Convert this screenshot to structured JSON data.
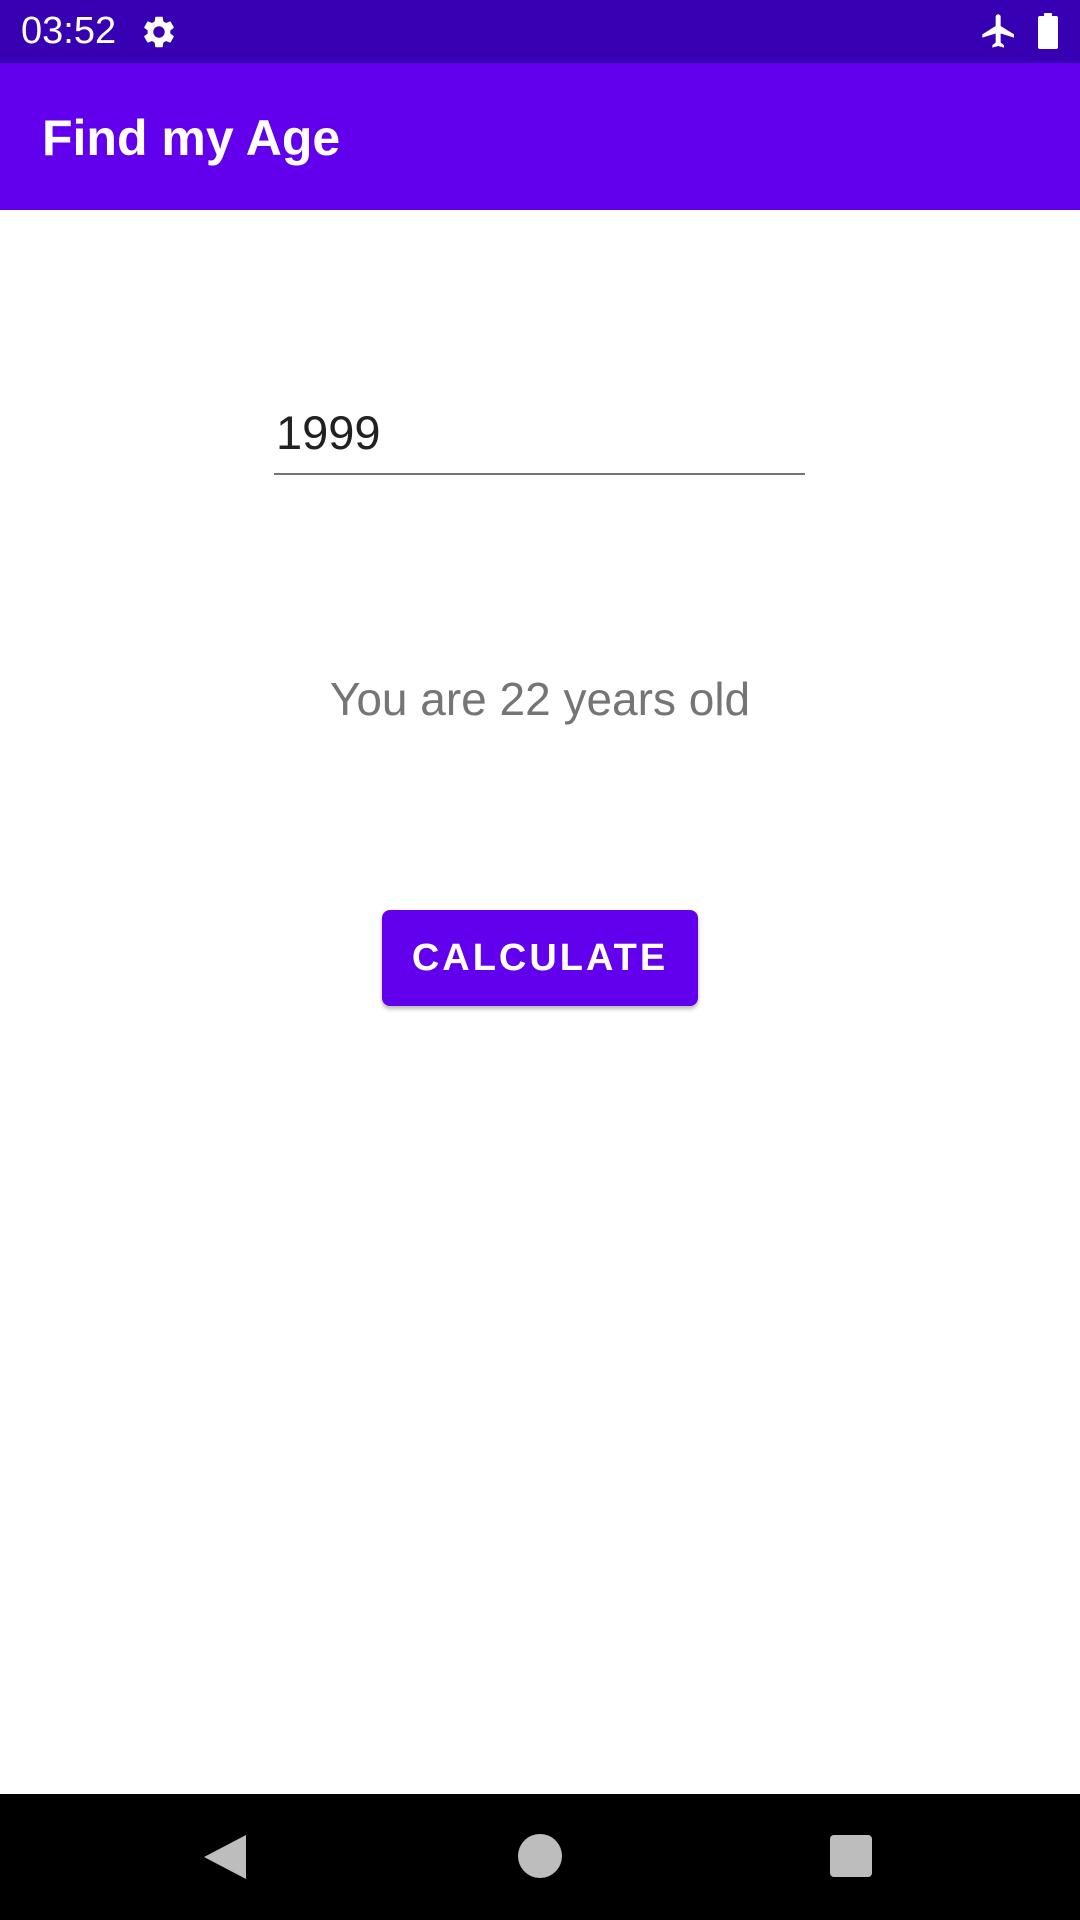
{
  "status_bar": {
    "time": "03:52",
    "icons": [
      "gear-icon",
      "airplane-mode-icon",
      "battery-icon"
    ],
    "background_color": "#3700b3"
  },
  "app_bar": {
    "title": "Find my Age",
    "background_color": "#6200ee"
  },
  "main": {
    "birth_year_input": {
      "value": "1999"
    },
    "result_text": "You are 22 years old",
    "calculate_button": {
      "label": "CALCULATE",
      "color": "#6200ee"
    }
  },
  "navigation_bar": {
    "icons": [
      "back-icon",
      "home-icon",
      "recent-apps-icon"
    ]
  }
}
